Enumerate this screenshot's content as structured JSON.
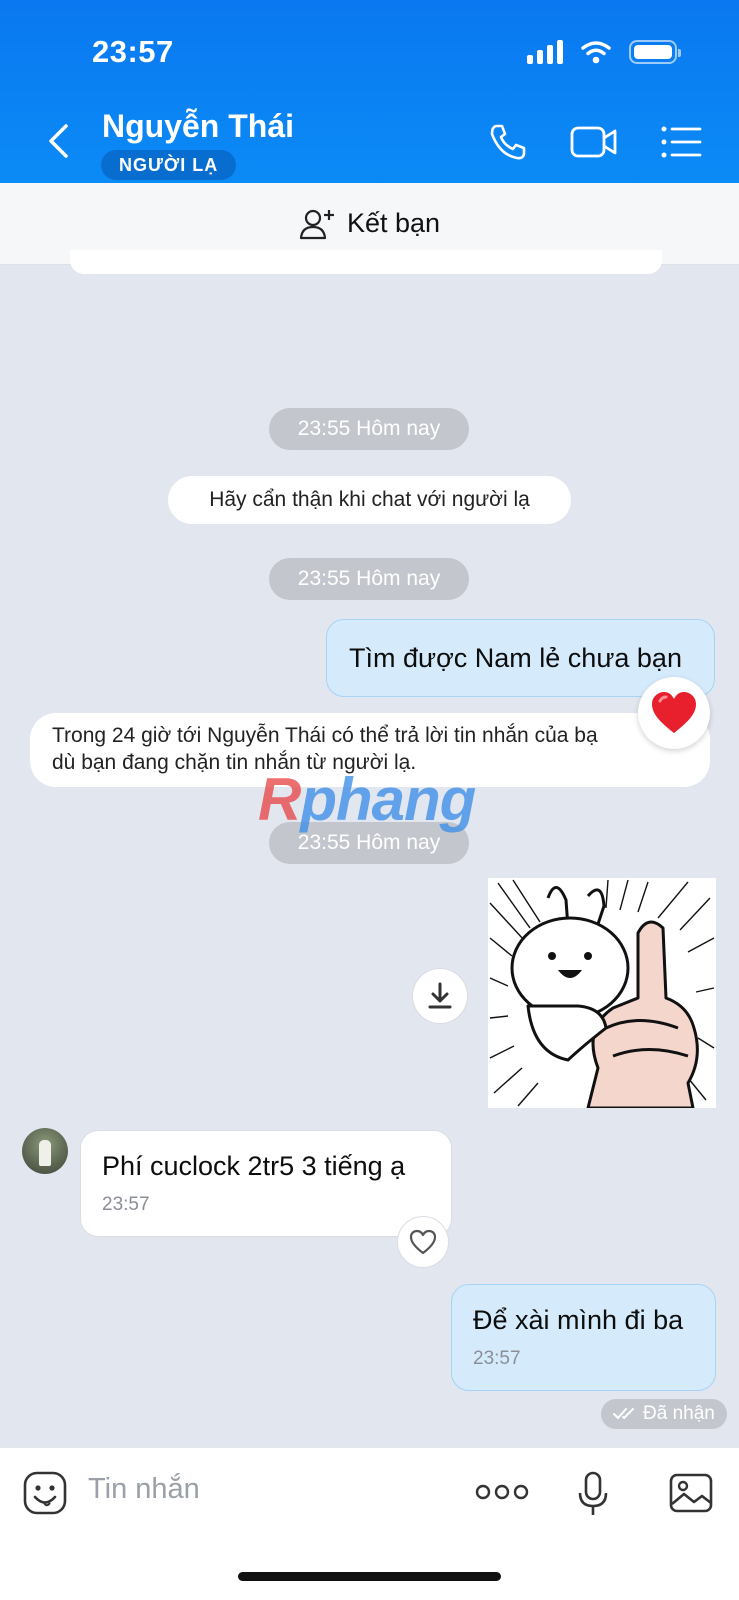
{
  "status_bar": {
    "time": "23:57"
  },
  "header": {
    "contact_name": "Nguyễn Thái",
    "badge": "NGƯỜI LẠ"
  },
  "add_friend": {
    "label": "Kết bạn"
  },
  "messages": {
    "time_1": "23:55 Hôm nay",
    "warning": "Hãy cẩn thận khi chat với người lạ",
    "time_2": "23:55 Hôm nay",
    "out_1": "Tìm được Nam lẻ chưa bạn",
    "notice_line_1": "Trong 24 giờ tới Nguyễn Thái có thể trả lời tin nhắn của bạ",
    "notice_line_2": "dù bạn đang chặn tin nhắn từ người lạ.",
    "time_3": "23:55 Hôm nay",
    "in_1_text": "Phí cuclock 2tr5 3 tiếng ạ",
    "in_1_time": "23:57",
    "out_2_text": "Để xài mình đi ba",
    "out_2_time": "23:57",
    "status": "Đã nhận"
  },
  "watermark": {
    "first": "R",
    "rest": "phang"
  },
  "input": {
    "placeholder": "Tin nhắn"
  },
  "colors": {
    "header": "#0a78f0",
    "outgoing_bubble": "#d5ebfc",
    "chat_bg": "#e2e6ee",
    "heart": "#e8202e"
  },
  "icons": [
    "back-icon",
    "phone-icon",
    "video-icon",
    "menu-icon",
    "add-friend-icon",
    "heart-icon",
    "download-icon",
    "like-icon",
    "sticker-icon",
    "more-icon",
    "mic-icon",
    "image-icon",
    "checkmark-icon"
  ]
}
